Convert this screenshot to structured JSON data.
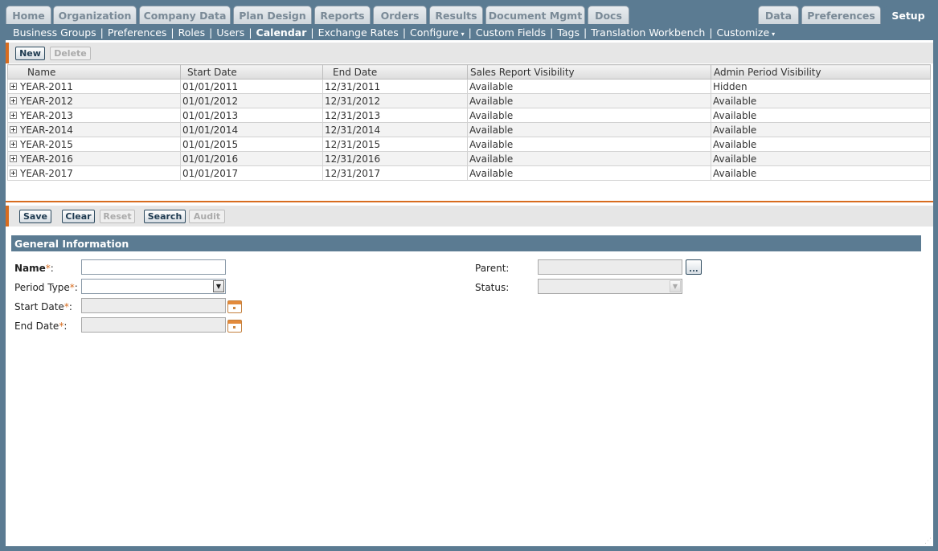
{
  "top_tabs": {
    "home": "Home",
    "organization": "Organization",
    "company_data": "Company Data",
    "plan_design": "Plan Design",
    "reports": "Reports",
    "orders": "Orders",
    "results": "Results",
    "document_mgmt": "Document Mgmt",
    "docs": "Docs",
    "data": "Data",
    "preferences": "Preferences",
    "setup": "Setup"
  },
  "subnav": {
    "business_groups": "Business Groups",
    "preferences": "Preferences",
    "roles": "Roles",
    "users": "Users",
    "calendar": "Calendar",
    "exchange_rates": "Exchange Rates",
    "configure": "Configure",
    "custom_fields": "Custom Fields",
    "tags": "Tags",
    "translation_workbench": "Translation Workbench",
    "customize": "Customize",
    "separator": "|",
    "caret": "▾"
  },
  "list_toolbar": {
    "new": "New",
    "delete": "Delete"
  },
  "grid": {
    "headers": [
      "Name",
      "Start Date",
      "End Date",
      "Sales Report Visibility",
      "Admin Period Visibility"
    ],
    "rows": [
      [
        "YEAR-2011",
        "01/01/2011",
        "12/31/2011",
        "Available",
        "Hidden"
      ],
      [
        "YEAR-2012",
        "01/01/2012",
        "12/31/2012",
        "Available",
        "Available"
      ],
      [
        "YEAR-2013",
        "01/01/2013",
        "12/31/2013",
        "Available",
        "Available"
      ],
      [
        "YEAR-2014",
        "01/01/2014",
        "12/31/2014",
        "Available",
        "Available"
      ],
      [
        "YEAR-2015",
        "01/01/2015",
        "12/31/2015",
        "Available",
        "Available"
      ],
      [
        "YEAR-2016",
        "01/01/2016",
        "12/31/2016",
        "Available",
        "Available"
      ],
      [
        "YEAR-2017",
        "01/01/2017",
        "12/31/2017",
        "Available",
        "Available"
      ]
    ]
  },
  "form_toolbar": {
    "save": "Save",
    "clear": "Clear",
    "reset": "Reset",
    "search": "Search",
    "audit": "Audit"
  },
  "form": {
    "section_title": "General Information",
    "name_label": "Name",
    "period_type_label": "Period Type",
    "start_date_label": "Start Date",
    "end_date_label": "End Date",
    "parent_label": "Parent:",
    "status_label": "Status:",
    "required_mark": "*",
    "colon": ":",
    "ellipsis": "...",
    "name_value": "",
    "period_type_value": "",
    "start_date_value": "",
    "end_date_value": "",
    "parent_value": "",
    "status_value": ""
  },
  "colors": {
    "frame": "#5b7b92",
    "accent": "#d86c1f",
    "required": "#d86c1f"
  }
}
